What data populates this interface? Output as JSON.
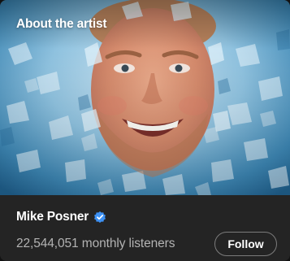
{
  "section": {
    "title": "About the artist"
  },
  "artist": {
    "name": "Mike Posner",
    "verified_icon": "verified-badge-icon",
    "monthly_listeners": "22,544,051 monthly listeners"
  },
  "actions": {
    "follow_label": "Follow"
  },
  "colors": {
    "card_background": "#242424",
    "verified_badge": "#3d91f4",
    "secondary_text": "#b3b3b3",
    "button_border": "#7c7c7c"
  }
}
